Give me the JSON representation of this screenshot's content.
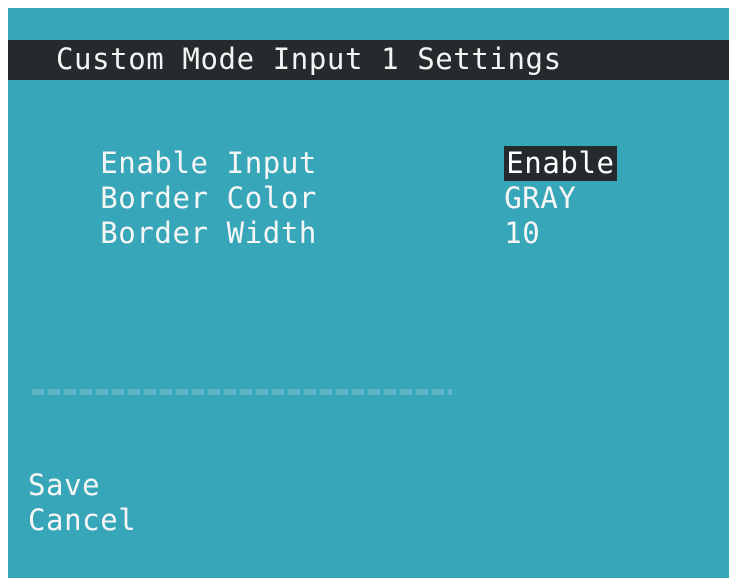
{
  "title": "Custom Mode Input 1 Settings",
  "settings": [
    {
      "label": "Enable Input",
      "value": "Enable",
      "selected": true
    },
    {
      "label": "Border Color",
      "value": "GRAY",
      "selected": false
    },
    {
      "label": "Border Width",
      "value": "10",
      "selected": false
    }
  ],
  "actions": {
    "save": "Save",
    "cancel": "Cancel"
  },
  "colors": {
    "background": "#37a6b9",
    "title_bar": "#252b2d",
    "highlight": "#252b2d",
    "text": "#ffffff"
  }
}
